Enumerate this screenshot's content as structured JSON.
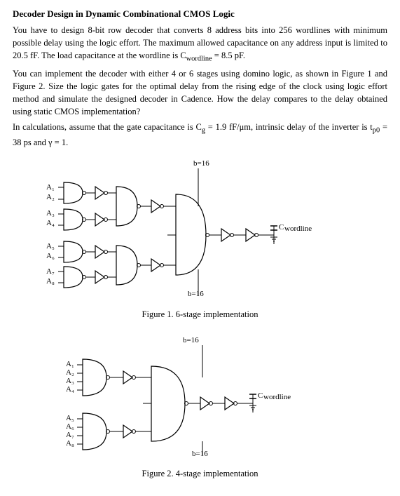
{
  "title": "Decoder Design in Dynamic Combinational CMOS Logic",
  "paragraphs": [
    "You have to design 8-bit row decoder that converts 8 address bits into 256 wordlines with minimum possible delay using the logic effort. The maximum allowed capacitance on any address input is limited to 20.5 fF. The load capacitance at the wordline is Cₘₒʳᵈₗᵉₙₑ = 8.5 pF.",
    "You can implement the decoder with either 4 or 6 stages using domino logic, as shown in Figure 1 and Figure 2. Size the logic gates for the optimal delay from the rising edge of the clock using logic effort method and simulate the designed decoder in Cadence. How the delay compares to the delay obtained using static CMOS implementation?",
    "In calculations, assume that the gate capacitance is Cᵍ = 1.9 fF/μm, intrinsic delay of the inverter is tₚ₀ = 38 ps and γ = 1."
  ],
  "figure1": {
    "caption": "Figure 1. 6-stage implementation"
  },
  "figure2": {
    "caption": "Figure 2. 4-stage implementation"
  }
}
